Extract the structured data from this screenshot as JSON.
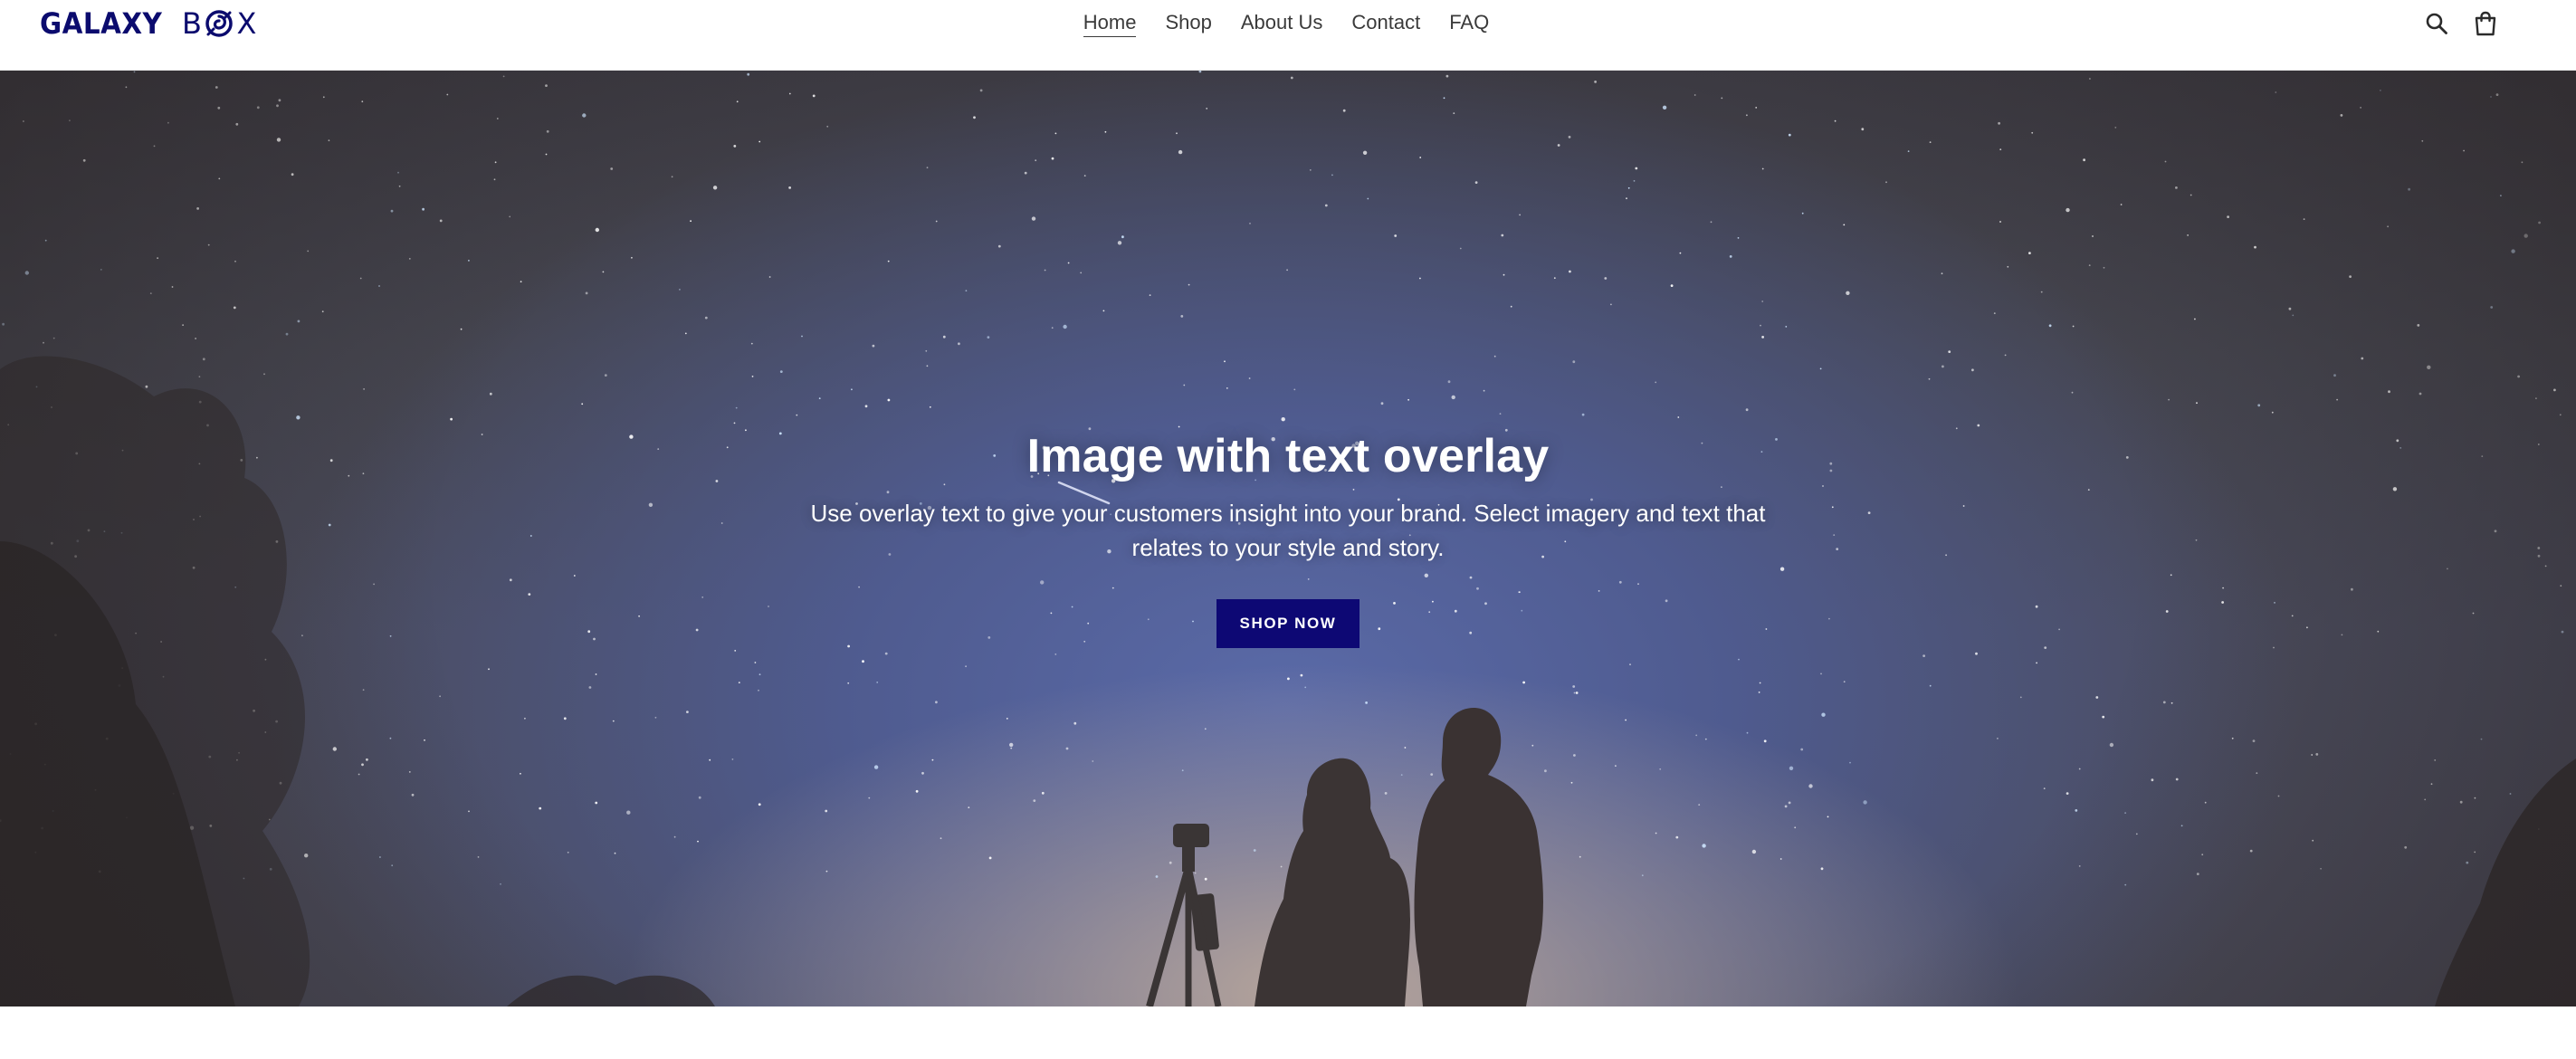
{
  "brand": {
    "logo_word1": "GALAXY",
    "logo_letter_b": "B",
    "logo_letter_x": "X",
    "logo_icon": "galaxy-swirl-icon",
    "color": "#0b0b6e"
  },
  "nav": {
    "items": [
      {
        "label": "Home",
        "active": true
      },
      {
        "label": "Shop",
        "active": false
      },
      {
        "label": "About Us",
        "active": false
      },
      {
        "label": "Contact",
        "active": false
      },
      {
        "label": "FAQ",
        "active": false
      }
    ]
  },
  "header_icons": {
    "search": "search-icon",
    "cart": "shopping-bag-icon"
  },
  "hero": {
    "title": "Image with text overlay",
    "text": "Use overlay text to give your customers insight into your brand. Select imagery and text that relates to your style and story.",
    "button_label": "SHOP NOW",
    "button_color": "#0d0874"
  }
}
